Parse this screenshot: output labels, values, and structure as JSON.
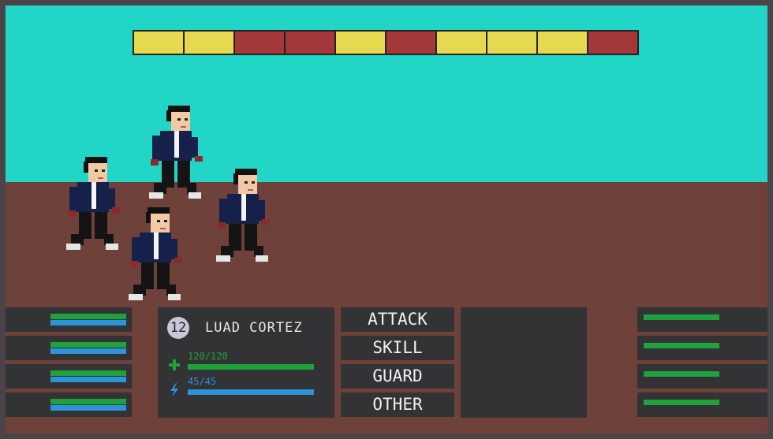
{
  "turn_order": [
    {
      "side": "ally",
      "color": "#e4d94f"
    },
    {
      "side": "ally",
      "color": "#e4d94f"
    },
    {
      "side": "enemy",
      "color": "#a3373a"
    },
    {
      "side": "enemy",
      "color": "#a3373a"
    },
    {
      "side": "ally",
      "color": "#e4d94f"
    },
    {
      "side": "enemy",
      "color": "#a3373a"
    },
    {
      "side": "ally",
      "color": "#e4d94f"
    },
    {
      "side": "ally",
      "color": "#e4d94f"
    },
    {
      "side": "ally",
      "color": "#e4d94f"
    },
    {
      "side": "enemy",
      "color": "#a3373a"
    }
  ],
  "party": [
    {
      "hp": 1.0,
      "mp": 1.0
    },
    {
      "hp": 1.0,
      "mp": 1.0
    },
    {
      "hp": 1.0,
      "mp": 1.0
    },
    {
      "hp": 1.0,
      "mp": 1.0
    }
  ],
  "enemies": [
    {
      "hp": 1.0
    },
    {
      "hp": 1.0
    },
    {
      "hp": 1.0
    },
    {
      "hp": 1.0
    }
  ],
  "character": {
    "level": "12",
    "name": "LUAD CORTEZ",
    "hp_text": "120/120",
    "hp_ratio": 1.0,
    "mp_text": "45/45",
    "mp_ratio": 1.0,
    "hp_icon": "plus-icon",
    "mp_icon": "lightning-icon"
  },
  "commands": {
    "attack": "ATTACK",
    "skill": "SKILL",
    "guard": "GUARD",
    "other": "OTHER"
  },
  "colors": {
    "sky": "#21d5c7",
    "ground": "#6e423b",
    "hp": "#1ea23b",
    "mp": "#2c93d8",
    "panel": "#333235"
  }
}
